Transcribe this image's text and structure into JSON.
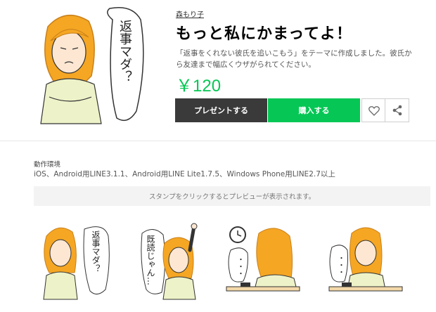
{
  "main_sticker": {
    "bubble_text": "返事マダ？",
    "icon": "sticker-main-image"
  },
  "author": "森もり子",
  "title": "もっと私にかまってよ！",
  "description": "「返事をくれない彼氏を追いこもう」をテーマに作成しました。彼氏から友達まで幅広くウザがられてください。",
  "price": "￥120",
  "buttons": {
    "present": "プレゼントする",
    "buy": "購入する",
    "like_icon": "heart-icon",
    "share_icon": "share-icon"
  },
  "environment": {
    "label": "動作環境",
    "text": "iOS、Android用LINE3.1.1、Android用LINE Lite1.7.5、Windows Phone用LINE2.7以上"
  },
  "hint": "スタンプをクリックするとプレビューが表示されます。",
  "stickers": [
    {
      "name": "sticker-1",
      "bubble_text": "返事マダ？"
    },
    {
      "name": "sticker-2",
      "bubble_text": "既読じゃん…"
    },
    {
      "name": "sticker-3",
      "bubble_text": "・・・"
    },
    {
      "name": "sticker-4",
      "bubble_text": "・・・"
    }
  ],
  "colors": {
    "brand_green": "#06c755",
    "hair": "#f5a623",
    "shirt": "#eef2c8",
    "dark_button": "#3a3a3a"
  }
}
